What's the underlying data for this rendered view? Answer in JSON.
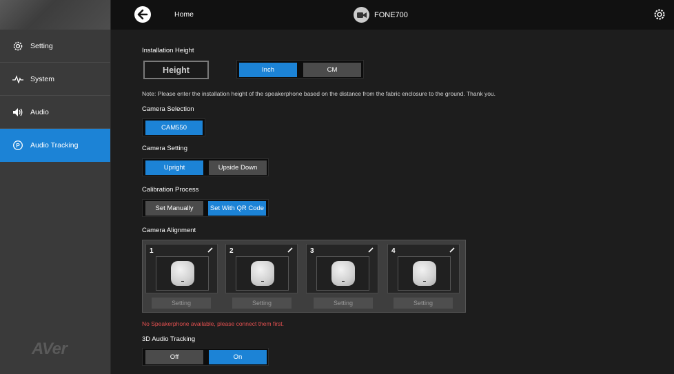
{
  "header": {
    "home_label": "Home",
    "device_name": "FONE700"
  },
  "sidebar": {
    "items": [
      {
        "label": "Setting",
        "icon": "gear-icon"
      },
      {
        "label": "System",
        "icon": "pulse-icon"
      },
      {
        "label": "Audio",
        "icon": "speaker-icon"
      },
      {
        "label": "Audio Tracking",
        "icon": "tracking-icon",
        "active": true
      }
    ],
    "brand": "AVer"
  },
  "main": {
    "installation_height": {
      "label": "Installation Height",
      "field_value": "Height",
      "units": [
        "Inch",
        "CM"
      ],
      "selected_unit": "Inch",
      "note": "Note: Please enter the installation height of the speakerphone based on the distance from the fabric enclosure to the ground. Thank you."
    },
    "camera_selection": {
      "label": "Camera Selection",
      "value": "CAM550"
    },
    "camera_setting": {
      "label": "Camera Setting",
      "options": [
        "Upright",
        "Upside Down"
      ],
      "selected": "Upright"
    },
    "calibration": {
      "label": "Calibration Process",
      "options": [
        "Set Manually",
        "Set With QR Code"
      ],
      "selected": "Set With QR Code"
    },
    "alignment": {
      "label": "Camera Alignment",
      "cards": [
        {
          "num": "1",
          "setting": "Setting"
        },
        {
          "num": "2",
          "setting": "Setting"
        },
        {
          "num": "3",
          "setting": "Setting"
        },
        {
          "num": "4",
          "setting": "Setting"
        }
      ]
    },
    "warning": "No Speakerphone available, please connect them first.",
    "tracking_3d": {
      "label": "3D Audio Tracking",
      "options": [
        "Off",
        "On"
      ],
      "selected": "On"
    }
  },
  "colors": {
    "accent": "#1c83d6",
    "warning": "#e45050"
  }
}
